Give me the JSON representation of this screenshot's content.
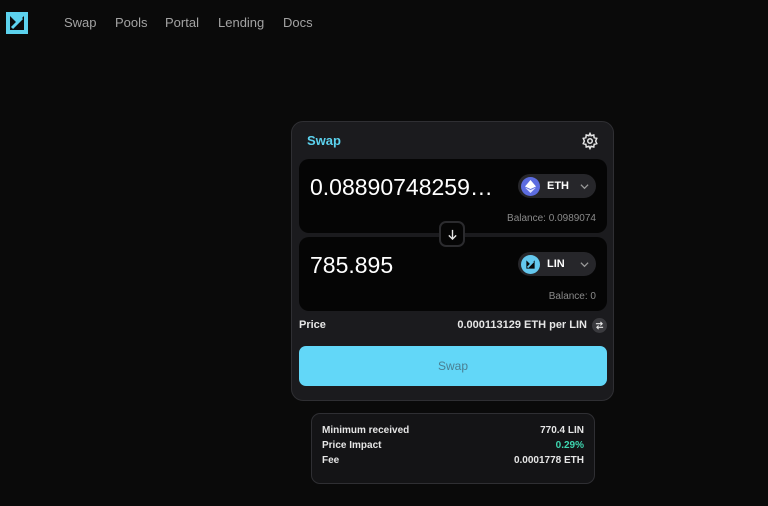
{
  "nav": {
    "items": [
      "Swap",
      "Pools",
      "Portal",
      "Lending",
      "Docs"
    ]
  },
  "colors": {
    "accent": "#5cd2ee",
    "swap_button": "#62d7f8",
    "positive": "#3ed6b0",
    "eth_icon": "#5c6ce0",
    "lin_icon": "#64c8ee"
  },
  "swap": {
    "title": "Swap",
    "from": {
      "amount": "0.088907482595...",
      "token": "ETH",
      "token_icon": "ethereum-icon",
      "balance": "Balance: 0.0989074"
    },
    "to": {
      "amount": "785.895",
      "token": "LIN",
      "token_icon": "lin-icon",
      "balance": "Balance: 0"
    },
    "price_label": "Price",
    "price_value": "0.000113129 ETH per LIN",
    "button_label": "Swap"
  },
  "summary": {
    "rows": [
      {
        "label": "Minimum received",
        "value": "770.4 LIN"
      },
      {
        "label": "Price Impact",
        "value": "0.29%"
      },
      {
        "label": "Fee",
        "value": "0.0001778 ETH"
      }
    ]
  }
}
